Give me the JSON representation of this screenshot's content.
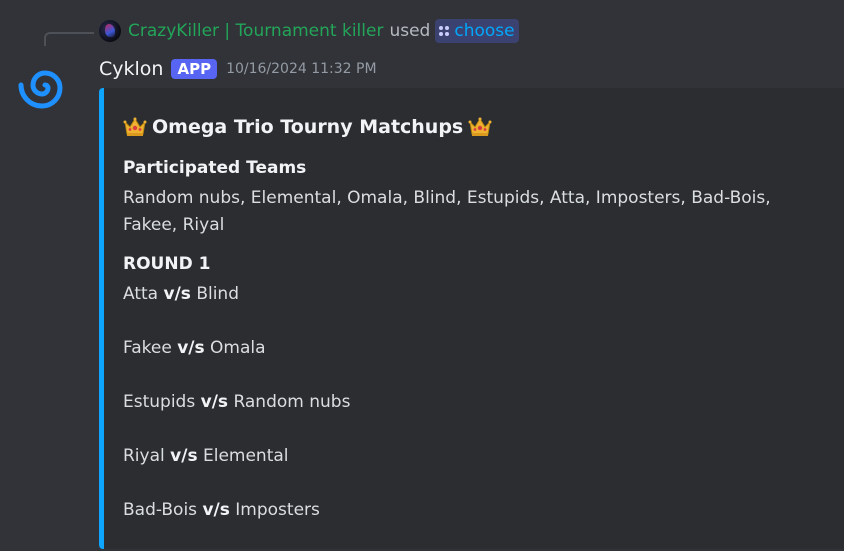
{
  "reply": {
    "user": "CrazyKiller | Tournament killer",
    "used_text": "used",
    "command": "choose"
  },
  "message": {
    "author": "Cyklon",
    "tag": "APP",
    "timestamp": "10/16/2024 11:32 PM"
  },
  "embed": {
    "accent_color": "#0ea5ff",
    "title": "Omega Trio Tourny Matchups",
    "fields": [
      {
        "name": "Participated Teams",
        "value": "Random nubs, Elemental, Omala, Blind, Estupids, Atta, Imposters, Bad-Bois, Fakee, Riyal"
      },
      {
        "name": "ROUND 1",
        "matches": [
          {
            "team_a": "Atta",
            "vs": "v/s",
            "team_b": "Blind"
          },
          {
            "team_a": "Fakee",
            "vs": "v/s",
            "team_b": "Omala"
          },
          {
            "team_a": "Estupids",
            "vs": "v/s",
            "team_b": "Random nubs"
          },
          {
            "team_a": "Riyal",
            "vs": "v/s",
            "team_b": "Elemental"
          },
          {
            "team_a": "Bad-Bois",
            "vs": "v/s",
            "team_b": "Imposters"
          }
        ]
      }
    ]
  },
  "icons": {
    "avatar": "spiral-avatar-icon",
    "command": "slash-command-icon",
    "crown": "crown-icon"
  },
  "colors": {
    "background": "#313338",
    "embed_bg": "#2b2d31",
    "reply_user": "#23a559",
    "app_tag": "#5865f2",
    "command_link": "#00a8fc"
  }
}
